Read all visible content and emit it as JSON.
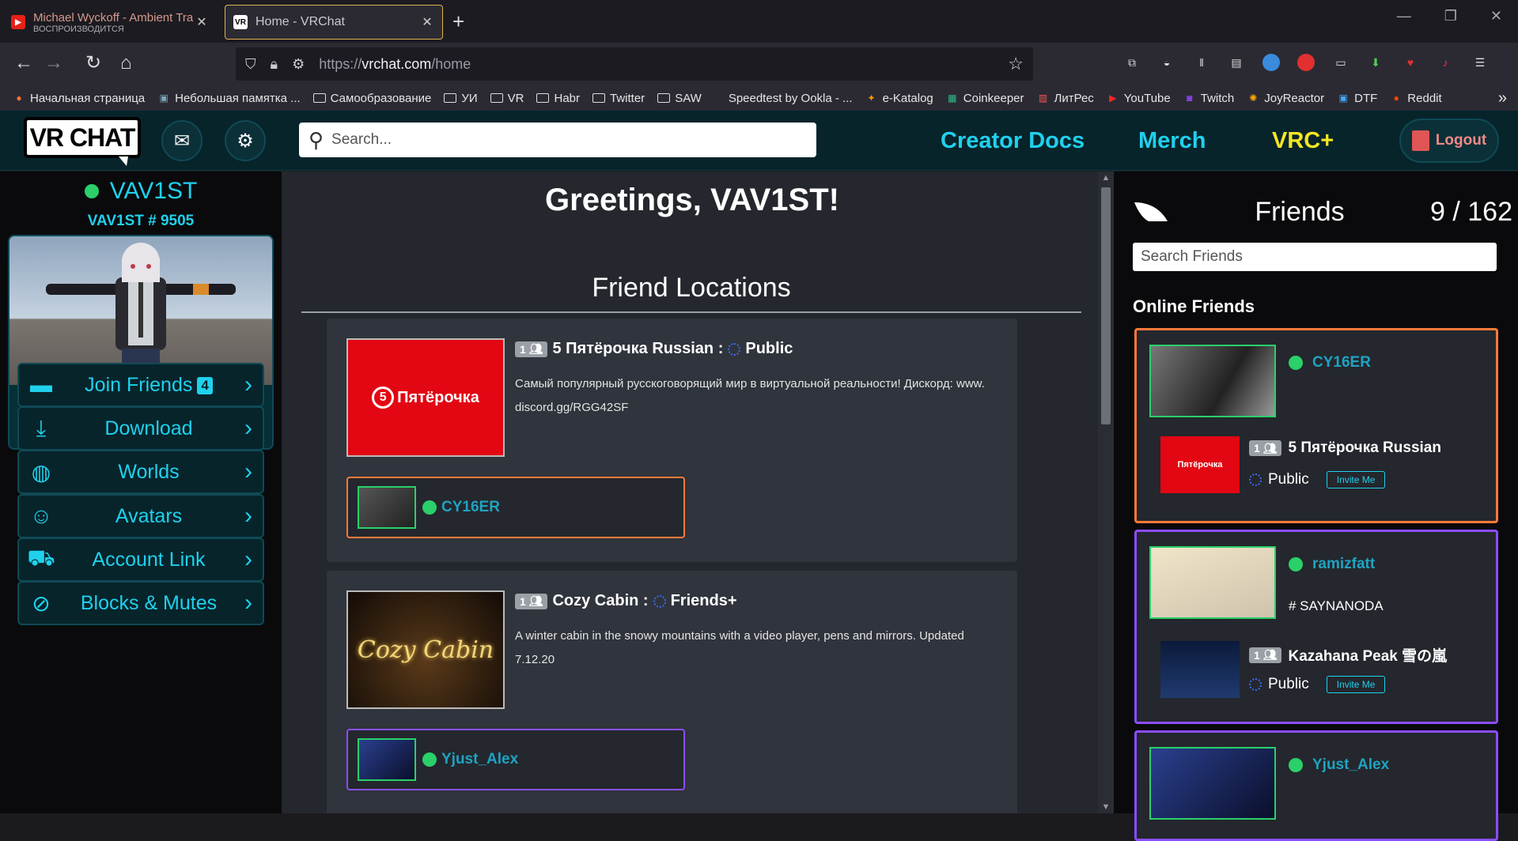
{
  "browser": {
    "tabs": [
      {
        "title": "Michael Wyckoff - Ambient Tra",
        "subtitle": "ВОСПРОИЗВОДИТСЯ",
        "favicon": "youtube-icon"
      },
      {
        "title": "Home - VRChat",
        "favicon": "vrchat-icon"
      }
    ],
    "url_prefix": "https://",
    "url_domain": "vrchat.com",
    "url_path": "/home",
    "bookmarks": [
      {
        "label": "Начальная страница",
        "icon": "firefox-icon"
      },
      {
        "label": "Небольшая памятка ...",
        "icon": "page-icon"
      },
      {
        "label": "Самообразование",
        "icon": "folder-icon"
      },
      {
        "label": "УИ",
        "icon": "folder-icon"
      },
      {
        "label": "VR",
        "icon": "folder-icon"
      },
      {
        "label": "Habr",
        "icon": "folder-icon"
      },
      {
        "label": "Twitter",
        "icon": "folder-icon"
      },
      {
        "label": "SAW",
        "icon": "folder-icon"
      },
      {
        "label": "Speedtest by Ookla - ...",
        "icon": "none"
      },
      {
        "label": "e-Katalog",
        "icon": "ekatalog-icon"
      },
      {
        "label": "Coinkeeper",
        "icon": "coinkeeper-icon"
      },
      {
        "label": "ЛитРес",
        "icon": "litres-icon"
      },
      {
        "label": "YouTube",
        "icon": "youtube-icon"
      },
      {
        "label": "Twitch",
        "icon": "twitch-icon"
      },
      {
        "label": "JoyReactor",
        "icon": "joyreactor-icon"
      },
      {
        "label": "DTF",
        "icon": "dtf-icon"
      },
      {
        "label": "Reddit",
        "icon": "reddit-icon"
      }
    ]
  },
  "header": {
    "logo": "VR CHAT",
    "search_placeholder": "Search...",
    "links": {
      "creator_docs": "Creator Docs",
      "merch": "Merch",
      "vrcplus": "VRC+"
    },
    "logout": "Logout"
  },
  "profile": {
    "name": "VAV1ST",
    "tag": "VAV1ST # 9505"
  },
  "menu": {
    "join_friends": "Join Friends",
    "join_count": "4",
    "download": "Download",
    "worlds": "Worlds",
    "avatars": "Avatars",
    "account_link": "Account Link",
    "blocks_mutes": "Blocks & Mutes"
  },
  "main": {
    "greeting": "Greetings, VAV1ST!",
    "section": "Friend Locations",
    "locations": [
      {
        "count": "1",
        "world": "5 Пятёрочка Russian :",
        "access": "Public",
        "image_text": "Пятёрочка",
        "description": "Самый популярный русскоговорящий мир в виртуальной реальности! Дискорд: www. discord.gg/RGG42SF",
        "friend": "CY16ER"
      },
      {
        "count": "1",
        "world": "Cozy Cabin :",
        "access": "Friends+",
        "image_text": "Cozy Cabin",
        "description": "A winter cabin in the snowy mountains with a video player, pens and mirrors. Updated 7.12.20",
        "friend": "Yjust_Alex"
      }
    ]
  },
  "friends": {
    "title": "Friends",
    "count": "9 / 162",
    "search_placeholder": "Search Friends",
    "online_label": "Online Friends",
    "cards": [
      {
        "name": "CY16ER",
        "status": "",
        "count": "1",
        "world": "5 Пятёрочка Russian",
        "access": "Public",
        "invite": "Invite Me",
        "world_text": "Пятёрочка",
        "border": "#ff7a3a"
      },
      {
        "name": "ramizfatt",
        "status": "# SAYNANODA",
        "count": "1",
        "world": "Kazahana Peak 雪の嵐",
        "access": "Public",
        "invite": "Invite Me",
        "border": "#8c4dff"
      },
      {
        "name": "Yjust_Alex",
        "status": "",
        "border": "#8c4dff"
      }
    ]
  },
  "colors": {
    "accent": "#1fd1ed",
    "online": "#2ad06a",
    "vrcplus": "#f5e623",
    "header_bg": "#07242b"
  }
}
